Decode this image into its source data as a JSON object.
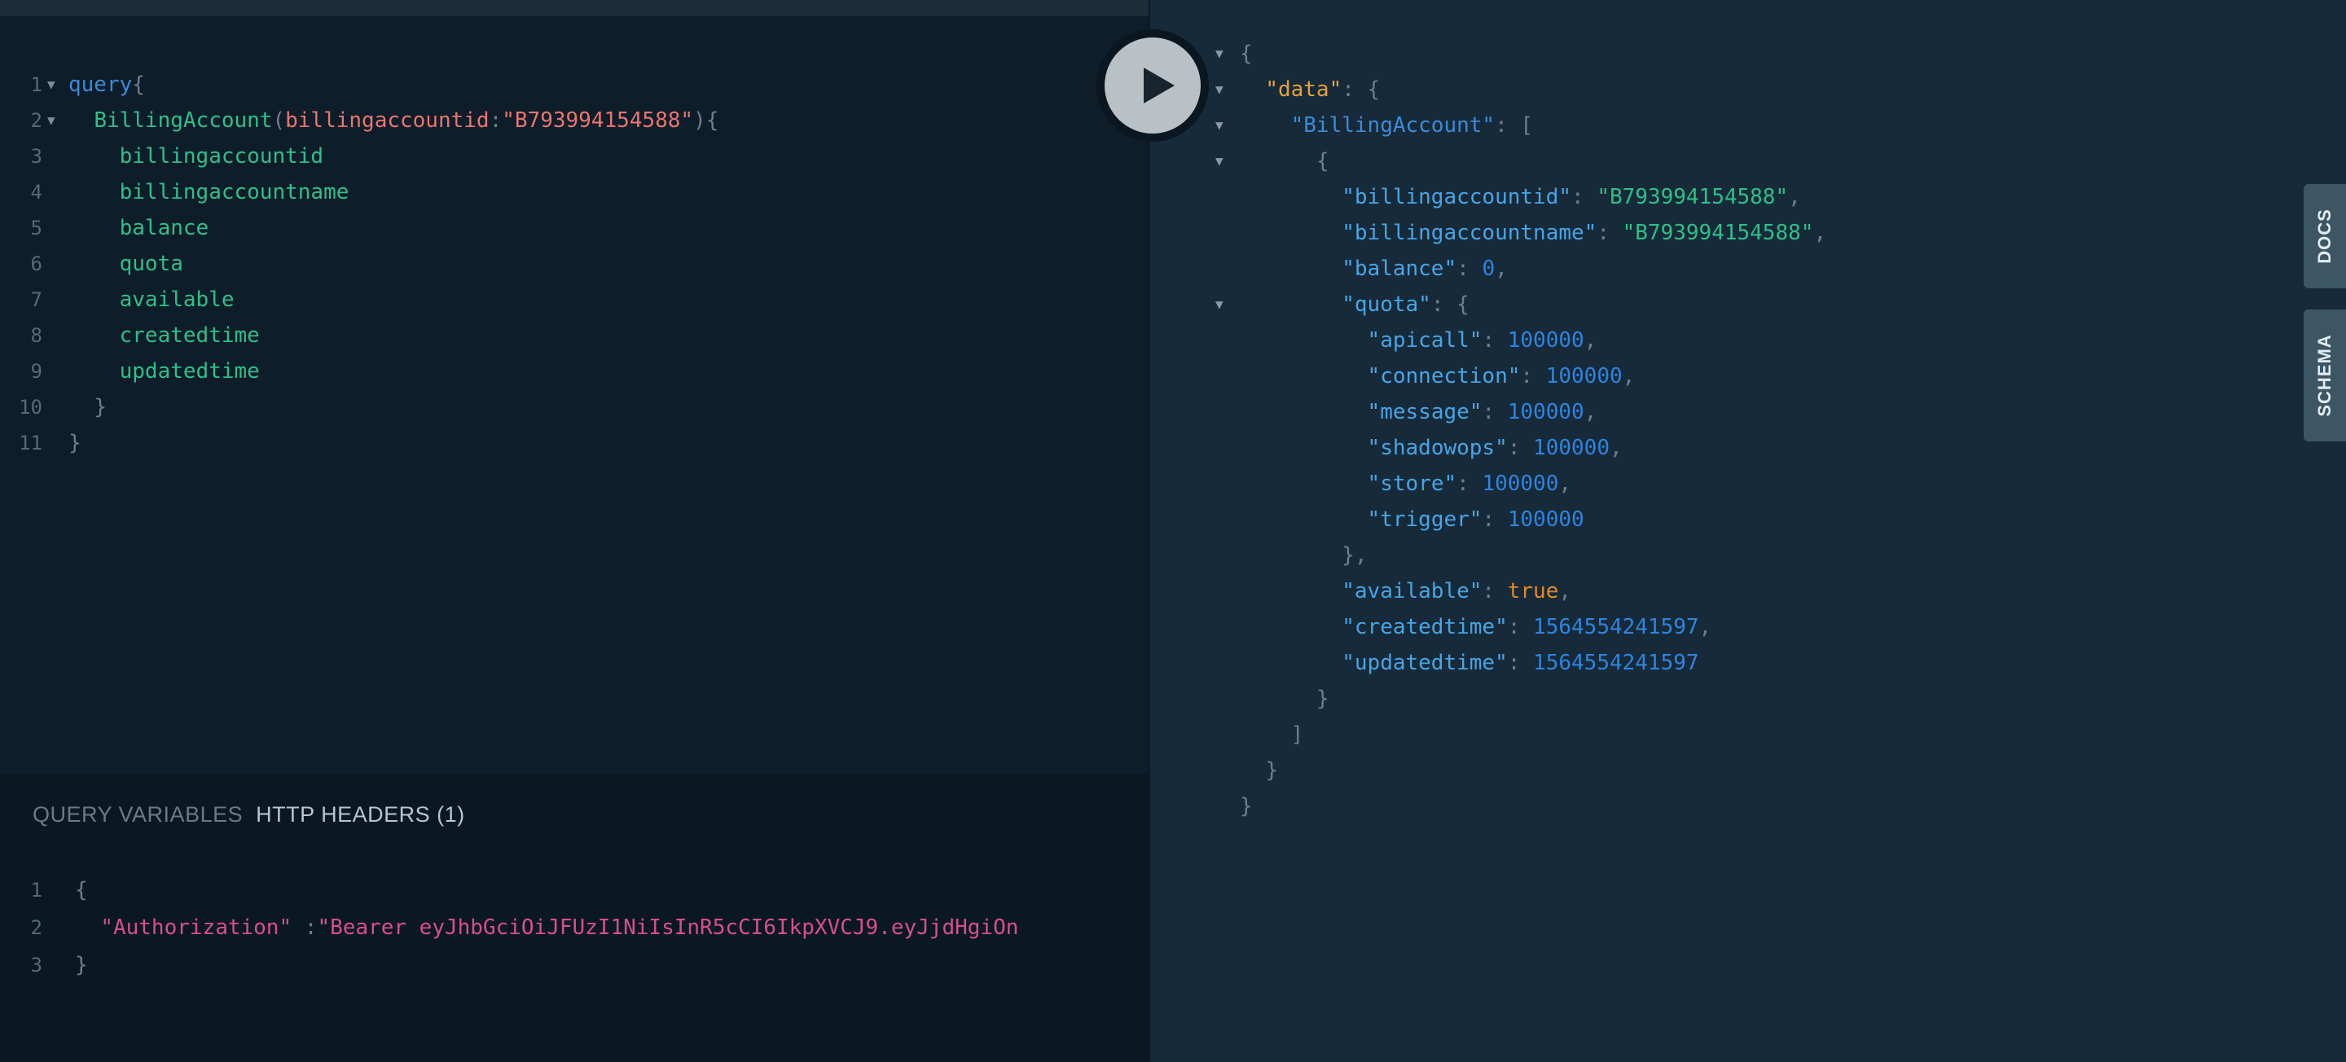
{
  "query_editor": {
    "lines": [
      {
        "n": "1",
        "fold": true,
        "indent": "",
        "tokens": [
          [
            "kw",
            "query"
          ],
          [
            "punct",
            "{"
          ]
        ]
      },
      {
        "n": "2",
        "fold": true,
        "indent": "  ",
        "tokens": [
          [
            "field",
            "BillingAccount"
          ],
          [
            "punct",
            "("
          ],
          [
            "arg",
            "billingaccountid"
          ],
          [
            "punct",
            ":"
          ],
          [
            "str",
            "\"B793994154588\""
          ],
          [
            "punct",
            ")"
          ],
          [
            "punct",
            "{"
          ]
        ]
      },
      {
        "n": "3",
        "fold": false,
        "indent": "    ",
        "tokens": [
          [
            "field",
            "billingaccountid"
          ]
        ]
      },
      {
        "n": "4",
        "fold": false,
        "indent": "    ",
        "tokens": [
          [
            "field",
            "billingaccountname"
          ]
        ]
      },
      {
        "n": "5",
        "fold": false,
        "indent": "    ",
        "tokens": [
          [
            "field",
            "balance"
          ]
        ]
      },
      {
        "n": "6",
        "fold": false,
        "indent": "    ",
        "tokens": [
          [
            "field",
            "quota"
          ]
        ]
      },
      {
        "n": "7",
        "fold": false,
        "indent": "    ",
        "tokens": [
          [
            "field",
            "available"
          ]
        ]
      },
      {
        "n": "8",
        "fold": false,
        "indent": "    ",
        "tokens": [
          [
            "field",
            "createdtime"
          ]
        ]
      },
      {
        "n": "9",
        "fold": false,
        "indent": "    ",
        "tokens": [
          [
            "field",
            "updatedtime"
          ]
        ]
      },
      {
        "n": "10",
        "fold": false,
        "indent": "  ",
        "tokens": [
          [
            "punct",
            "}"
          ]
        ]
      },
      {
        "n": "11",
        "fold": false,
        "indent": "",
        "tokens": [
          [
            "punct",
            "}"
          ]
        ]
      }
    ]
  },
  "variables_pane": {
    "tabs": [
      {
        "label": "QUERY VARIABLES",
        "active": false
      },
      {
        "label": "HTTP HEADERS (1)",
        "active": true
      }
    ],
    "lines": [
      {
        "n": "1",
        "indent": "",
        "tokens": [
          [
            "punct",
            "{"
          ]
        ]
      },
      {
        "n": "2",
        "indent": "  ",
        "tokens": [
          [
            "key",
            "\"Authorization\""
          ],
          [
            "punct",
            " :"
          ],
          [
            "str2",
            "\"Bearer eyJhbGciOiJFUzI1NiIsInR5cCI6IkpXVCJ9.eyJjdHgiOn"
          ]
        ]
      },
      {
        "n": "3",
        "indent": "",
        "tokens": [
          [
            "punct",
            "}"
          ]
        ]
      }
    ]
  },
  "execute_button": {
    "icon": "play-icon"
  },
  "result": {
    "lines": [
      {
        "fold": true,
        "indent": "",
        "tokens": [
          [
            "punct",
            "{"
          ]
        ]
      },
      {
        "fold": true,
        "indent": "  ",
        "tokens": [
          [
            "key-orange",
            "\"data\""
          ],
          [
            "punct",
            ": {"
          ]
        ]
      },
      {
        "fold": true,
        "indent": "    ",
        "tokens": [
          [
            "key-blue",
            "\"BillingAccount\""
          ],
          [
            "punct",
            ": ["
          ]
        ]
      },
      {
        "fold": true,
        "indent": "      ",
        "tokens": [
          [
            "punct",
            "{"
          ]
        ]
      },
      {
        "fold": false,
        "indent": "        ",
        "tokens": [
          [
            "key",
            "\"billingaccountid\""
          ],
          [
            "punct",
            ": "
          ],
          [
            "str",
            "\"B793994154588\""
          ],
          [
            "punct",
            ","
          ]
        ]
      },
      {
        "fold": false,
        "indent": "        ",
        "tokens": [
          [
            "key",
            "\"billingaccountname\""
          ],
          [
            "punct",
            ": "
          ],
          [
            "str",
            "\"B793994154588\""
          ],
          [
            "punct",
            ","
          ]
        ]
      },
      {
        "fold": false,
        "indent": "        ",
        "tokens": [
          [
            "key",
            "\"balance\""
          ],
          [
            "punct",
            ": "
          ],
          [
            "num",
            "0"
          ],
          [
            "punct",
            ","
          ]
        ]
      },
      {
        "fold": true,
        "indent": "        ",
        "tokens": [
          [
            "key",
            "\"quota\""
          ],
          [
            "punct",
            ": {"
          ]
        ]
      },
      {
        "fold": false,
        "indent": "          ",
        "tokens": [
          [
            "key",
            "\"apicall\""
          ],
          [
            "punct",
            ": "
          ],
          [
            "num",
            "100000"
          ],
          [
            "punct",
            ","
          ]
        ]
      },
      {
        "fold": false,
        "indent": "          ",
        "tokens": [
          [
            "key",
            "\"connection\""
          ],
          [
            "punct",
            ": "
          ],
          [
            "num",
            "100000"
          ],
          [
            "punct",
            ","
          ]
        ]
      },
      {
        "fold": false,
        "indent": "          ",
        "tokens": [
          [
            "key",
            "\"message\""
          ],
          [
            "punct",
            ": "
          ],
          [
            "num",
            "100000"
          ],
          [
            "punct",
            ","
          ]
        ]
      },
      {
        "fold": false,
        "indent": "          ",
        "tokens": [
          [
            "key",
            "\"shadowops\""
          ],
          [
            "punct",
            ": "
          ],
          [
            "num",
            "100000"
          ],
          [
            "punct",
            ","
          ]
        ]
      },
      {
        "fold": false,
        "indent": "          ",
        "tokens": [
          [
            "key",
            "\"store\""
          ],
          [
            "punct",
            ": "
          ],
          [
            "num",
            "100000"
          ],
          [
            "punct",
            ","
          ]
        ]
      },
      {
        "fold": false,
        "indent": "          ",
        "tokens": [
          [
            "key",
            "\"trigger\""
          ],
          [
            "punct",
            ": "
          ],
          [
            "num",
            "100000"
          ]
        ]
      },
      {
        "fold": false,
        "indent": "        ",
        "tokens": [
          [
            "punct",
            "},"
          ]
        ]
      },
      {
        "fold": false,
        "indent": "        ",
        "tokens": [
          [
            "key",
            "\"available\""
          ],
          [
            "punct",
            ": "
          ],
          [
            "bool",
            "true"
          ],
          [
            "punct",
            ","
          ]
        ]
      },
      {
        "fold": false,
        "indent": "        ",
        "tokens": [
          [
            "key",
            "\"createdtime\""
          ],
          [
            "punct",
            ": "
          ],
          [
            "num",
            "1564554241597"
          ],
          [
            "punct",
            ","
          ]
        ]
      },
      {
        "fold": false,
        "indent": "        ",
        "tokens": [
          [
            "key",
            "\"updatedtime\""
          ],
          [
            "punct",
            ": "
          ],
          [
            "num",
            "1564554241597"
          ]
        ]
      },
      {
        "fold": false,
        "indent": "      ",
        "tokens": [
          [
            "punct",
            "}"
          ]
        ]
      },
      {
        "fold": false,
        "indent": "    ",
        "tokens": [
          [
            "punct",
            "]"
          ]
        ]
      },
      {
        "fold": false,
        "indent": "  ",
        "tokens": [
          [
            "punct",
            "}"
          ]
        ]
      },
      {
        "fold": false,
        "indent": "",
        "tokens": [
          [
            "punct",
            "}"
          ]
        ]
      }
    ]
  },
  "side_tabs": {
    "docs_label": "DOCS",
    "schema_label": "SCHEMA"
  },
  "colors": {
    "background": "#0f202d",
    "result_background": "#172a39",
    "keyword": "#3d8ad8",
    "field": "#2fbf87",
    "string": "#e9756e",
    "number": "#2e84e0",
    "boolean": "#e08a2c"
  }
}
